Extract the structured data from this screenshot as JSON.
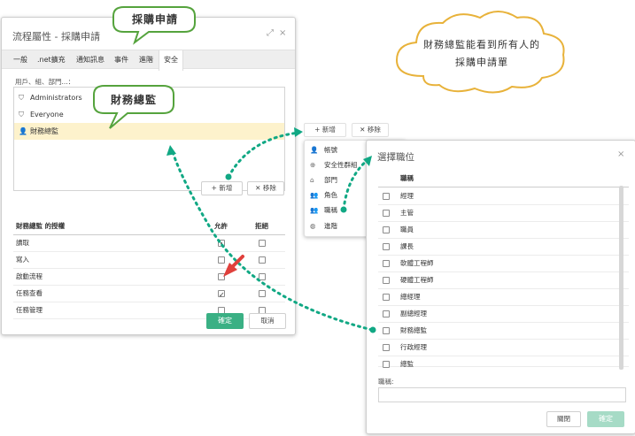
{
  "dialog1": {
    "title": "流程屬性 - 採購申請",
    "expand": "⤢",
    "close": "×",
    "tabs": [
      {
        "label": "一般"
      },
      {
        "label": ".net擴充"
      },
      {
        "label": "通知訊息"
      },
      {
        "label": "事件"
      },
      {
        "label": "進階"
      },
      {
        "label": "安全"
      }
    ],
    "users_label": "用戶、組、部門...：",
    "users": [
      {
        "name": "Administrators"
      },
      {
        "name": "Everyone"
      },
      {
        "name": "財務總監"
      }
    ],
    "add_label": "+ 新增",
    "remove_label": "✕ 移除",
    "perm_header": {
      "name": "財務總監 的授權",
      "allow": "允許",
      "deny": "拒絕"
    },
    "permissions": [
      {
        "name": "讀取",
        "allow": "indeterminate",
        "deny": false
      },
      {
        "name": "寫入",
        "allow": false,
        "deny": false
      },
      {
        "name": "啟動流程",
        "allow": false,
        "deny": false
      },
      {
        "name": "任務查看",
        "allow": true,
        "deny": false
      },
      {
        "name": "任務管理",
        "allow": false,
        "deny": false
      }
    ],
    "ok_label": "確定",
    "cancel_label": "取消"
  },
  "menu": {
    "add_label": "+ 新增",
    "remove_label": "✕ 移除",
    "items": [
      {
        "label": "帳號",
        "icon": "user-icon"
      },
      {
        "label": "安全性群組",
        "icon": "plus-circle-icon"
      },
      {
        "label": "部門",
        "icon": "home-icon"
      },
      {
        "label": "角色",
        "icon": "people-icon"
      },
      {
        "label": "職稱",
        "icon": "people-icon"
      },
      {
        "label": "進階",
        "icon": "globe-icon"
      }
    ]
  },
  "dialog2": {
    "title": "選擇職位",
    "close": "×",
    "col_header": "職稱",
    "jobs": [
      "經理",
      "主管",
      "職員",
      "課長",
      "軟體工程師",
      "硬體工程師",
      "總經理",
      "副總經理",
      "財務總監",
      "行政經理",
      "總監"
    ],
    "field_label": "職稱:",
    "field_value": "",
    "close_label": "關閉",
    "ok_label": "確定"
  },
  "callouts": {
    "top": "採購申請",
    "middle": "財務總監",
    "cloud_line1": "財務總監能看到所有人的",
    "cloud_line2": "採購申請單"
  },
  "colors": {
    "accent": "#3ab084",
    "callout_border": "#55a33d",
    "cloud_border": "#e8b23a",
    "selected_row": "#fdf2cc",
    "arrow": "#11a884"
  }
}
